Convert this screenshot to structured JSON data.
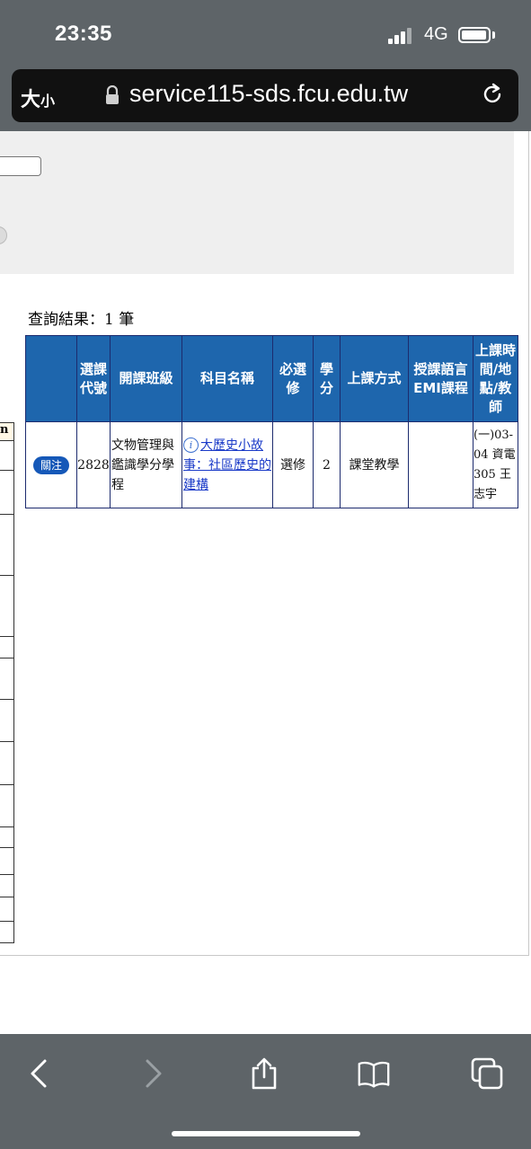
{
  "status_bar": {
    "time": "23:35",
    "network": "4G"
  },
  "address_bar": {
    "text_size_big": "大",
    "text_size_small": "小",
    "url": "service115-sds.fcu.edu.tw"
  },
  "results": {
    "summary": "查詢結果：1 筆",
    "headers": {
      "col_blank": "",
      "code": "選課代號",
      "class": "開課班級",
      "subject": "科目名稱",
      "required": "必選修",
      "credits": "學分",
      "method": "上課方式",
      "language": "授課語言EMI課程",
      "time_place": "上課時間/地點/教師"
    },
    "rows": [
      {
        "action": "關注",
        "code": "2828",
        "class": "文物管理與鑑識學分學程",
        "subject": "大歷史小故事：社區歷史的建構",
        "required": "選修",
        "credits": "2",
        "method": "課堂教學",
        "language": "",
        "time_place": "(一)03-04 資電305 王志宇"
      }
    ]
  },
  "left_strip_fragment": "n"
}
